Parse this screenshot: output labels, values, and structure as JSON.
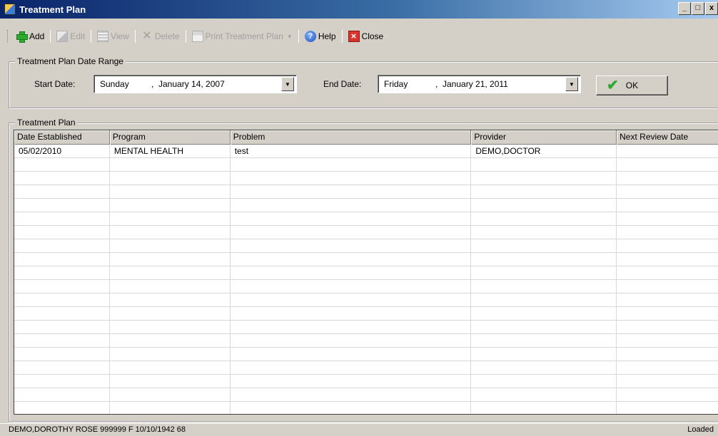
{
  "window": {
    "title": "Treatment Plan",
    "controls": [
      "_",
      "□",
      "x"
    ]
  },
  "toolbar": {
    "add_label": "Add",
    "edit_label": "Edit",
    "view_label": "View",
    "delete_label": "Delete",
    "print_label": "Print Treatment Plan",
    "help_label": "Help",
    "close_label": "Close"
  },
  "date_range": {
    "legend": "Treatment Plan Date Range",
    "start_label": "Start Date:",
    "start_day": "Sunday",
    "start_date": "January  14, 2007",
    "end_label": "End Date:",
    "end_day": "Friday",
    "end_date": "January  21, 2011",
    "ok_label": "OK"
  },
  "plan": {
    "legend": "Treatment Plan",
    "columns": [
      "Date Established",
      "Program",
      "Problem",
      "Provider",
      "Next Review Date"
    ],
    "rows": [
      [
        "05/02/2010",
        "MENTAL HEALTH",
        "test",
        "DEMO,DOCTOR",
        ""
      ]
    ]
  },
  "status": {
    "patient": "DEMO,DOROTHY ROSE  999999  F  10/10/1942  68",
    "state": "Loaded"
  }
}
